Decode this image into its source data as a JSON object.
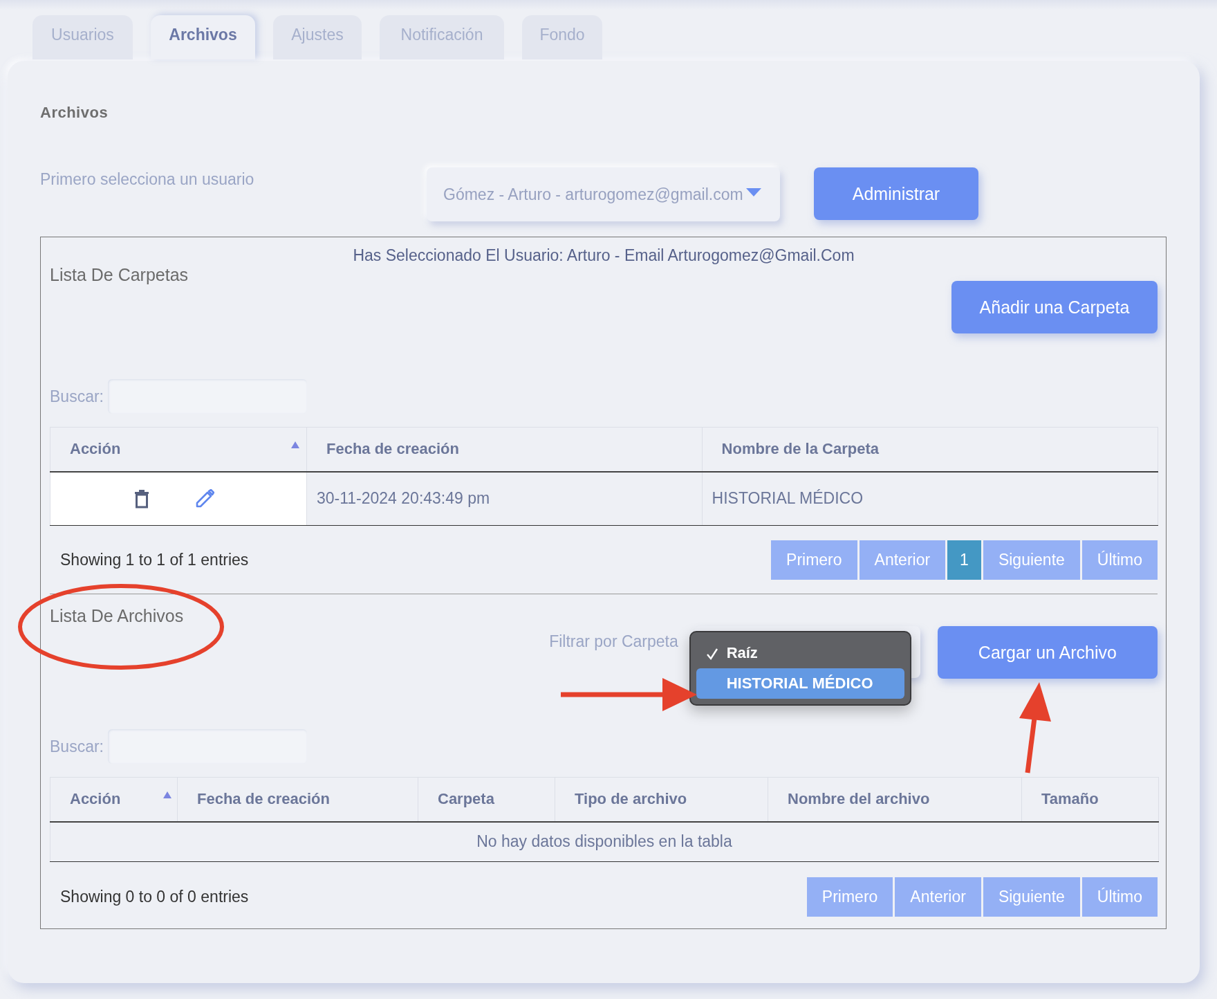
{
  "tabs": [
    {
      "label": "Usuarios",
      "selected": false
    },
    {
      "label": "Archivos",
      "selected": true
    },
    {
      "label": "Ajustes",
      "selected": false
    },
    {
      "label": "Notificación",
      "selected": false
    },
    {
      "label": "Fondo",
      "selected": false
    }
  ],
  "section_title": "Archivos",
  "user_select": {
    "label": "Primero selecciona un usuario",
    "value": "Gómez - Arturo - arturogomez@gmail.com"
  },
  "manage_button": "Administrar",
  "selected_user_note": "Has Seleccionado El Usuario: Arturo - Email Arturogomez@Gmail.Com",
  "folders": {
    "title": "Lista De Carpetas",
    "add_button": "Añadir una Carpeta",
    "search_label": "Buscar:",
    "table": {
      "columns": [
        {
          "label": "Acción",
          "sorted": true
        },
        {
          "label": "Fecha de creación",
          "sorted": false
        },
        {
          "label": "Nombre de la Carpeta",
          "sorted": false
        }
      ],
      "rows": [
        {
          "cells": [
            "",
            "30-11-2024 20:43:49 pm",
            "HISTORIAL MÉDICO"
          ]
        }
      ]
    },
    "info": "Showing 1 to 1 of 1 entries",
    "pagination": [
      {
        "label": "Primero",
        "selected": false
      },
      {
        "label": "Anterior",
        "selected": false
      },
      {
        "label": "1",
        "selected": true
      },
      {
        "label": "Siguiente",
        "selected": false
      },
      {
        "label": "Último",
        "selected": false
      }
    ]
  },
  "files": {
    "title": "Lista De Archivos",
    "filter_label": "Filtrar por Carpeta",
    "folder_options": [
      {
        "label": "Raíz",
        "checked": true,
        "selected": false
      },
      {
        "label": "HISTORIAL MÉDICO",
        "checked": false,
        "selected": true
      }
    ],
    "upload_button": "Cargar un Archivo",
    "search_label": "Buscar:",
    "table": {
      "columns": [
        {
          "label": "Acción",
          "sorted": true
        },
        {
          "label": "Fecha de creación",
          "sorted": false
        },
        {
          "label": "Carpeta",
          "sorted": false
        },
        {
          "label": "Tipo de archivo",
          "sorted": false
        },
        {
          "label": "Nombre del archivo",
          "sorted": false
        },
        {
          "label": "Tamaño",
          "sorted": false
        }
      ],
      "empty_message": "No hay datos disponibles en la tabla"
    },
    "info": "Showing 0 to 0 of 0 entries",
    "pagination": [
      {
        "label": "Primero",
        "selected": false
      },
      {
        "label": "Anterior",
        "selected": false
      },
      {
        "label": "Siguiente",
        "selected": false
      },
      {
        "label": "Último",
        "selected": false
      }
    ]
  }
}
